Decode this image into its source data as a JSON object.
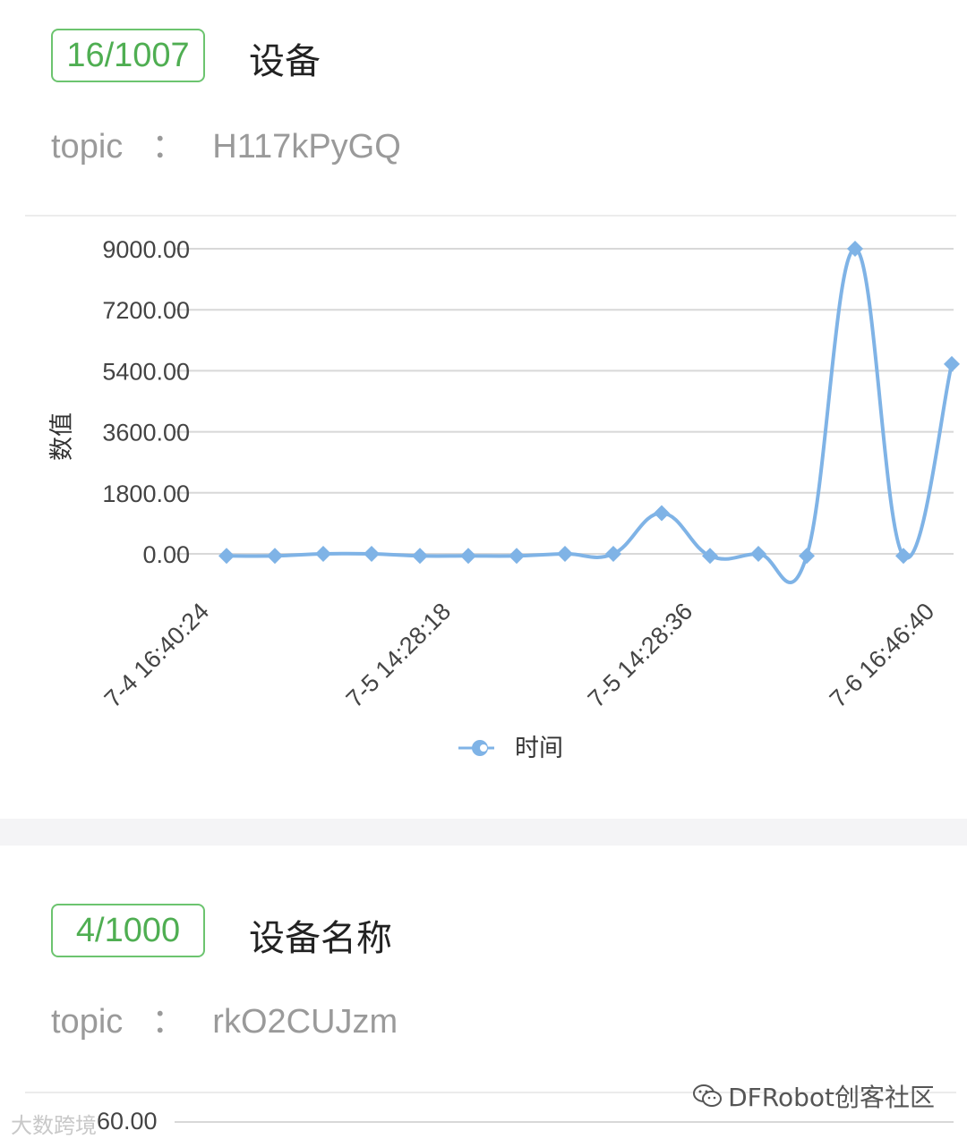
{
  "cards": [
    {
      "badge": "16/1007",
      "name": "设备",
      "topic_label": "topic",
      "topic_colon": "：",
      "topic_value": "H117kPyGQ"
    },
    {
      "badge": "4/1000",
      "name": "设备名称",
      "topic_label": "topic",
      "topic_colon": "：",
      "topic_value": "rkO2CUJzm",
      "partial_ytick": "60.00"
    }
  ],
  "chart_data": {
    "type": "line",
    "ylabel": "数值",
    "legend": "时间",
    "ylim": [
      0,
      9000
    ],
    "yticks": [
      "9000.00",
      "7200.00",
      "5400.00",
      "3600.00",
      "1800.00",
      "0.00"
    ],
    "xtick_labels": [
      "7-4 16:40:24",
      "7-5 14:28:18",
      "7-5 14:28:36",
      "7-6 16:46:40"
    ],
    "xtick_indices": [
      0,
      5,
      10,
      15
    ],
    "series": [
      {
        "name": "时间",
        "values": [
          -60,
          -60,
          0,
          0,
          -60,
          -60,
          -60,
          0,
          0,
          1200,
          -60,
          0,
          -60,
          9000,
          -60,
          5600
        ]
      }
    ],
    "colors": {
      "line": "#7fb3e6",
      "marker": "#7fb3e6",
      "grid": "#d8d8d8"
    }
  },
  "watermarks": {
    "left": "大数跨境",
    "right": "DFRobot创客社区"
  }
}
